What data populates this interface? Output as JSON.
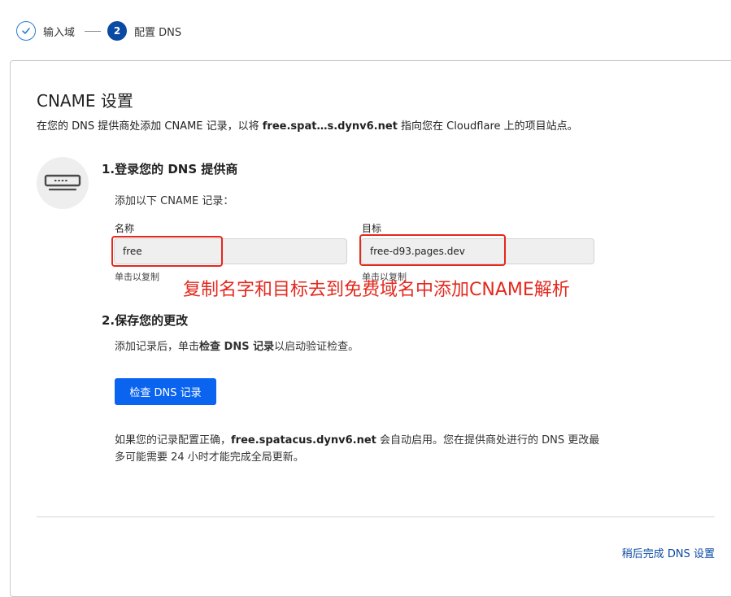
{
  "stepper": {
    "step1_label": "输入域",
    "step2_number": "2",
    "step2_label": "配置 DNS"
  },
  "cname": {
    "title": "CNAME 设置",
    "desc_prefix": "在您的 DNS 提供商处添加 CNAME 记录，以将 ",
    "desc_domain": "free.spat…s.dynv6.net",
    "desc_suffix": " 指向您在 Cloudflare 上的项目站点。"
  },
  "step_one": {
    "heading": "1.登录您的 DNS 提供商",
    "instruction": "添加以下 CNAME 记录：",
    "name_label": "名称",
    "name_value": "free",
    "name_hint": "单击以复制",
    "target_label": "目标",
    "target_value": "free-d93.pages.dev",
    "target_hint": "单击以复制"
  },
  "annotation": "复制名字和目标去到免费域名中添加CNAME解析",
  "step_two": {
    "heading": "2.保存您的更改",
    "instr_prefix": "添加记录后，单击",
    "instr_bold": "检查 DNS 记录",
    "instr_suffix": "以启动验证检查。",
    "button_label": "检查 DNS 记录"
  },
  "footer_note": {
    "prefix": "如果您的记录配置正确，",
    "domain": "free.spatacus.dynv6.net",
    "suffix": " 会自动启用。您在提供商处进行的 DNS 更改最多可能需要 24 小时才能完成全局更新。"
  },
  "later_link": "稍后完成 DNS 设置",
  "colors": {
    "accent": "#0a64f0",
    "step_active": "#0a4aa4",
    "annotation_red": "#e4281e"
  },
  "icons": {
    "step1": "check-icon",
    "provider": "server-icon"
  }
}
